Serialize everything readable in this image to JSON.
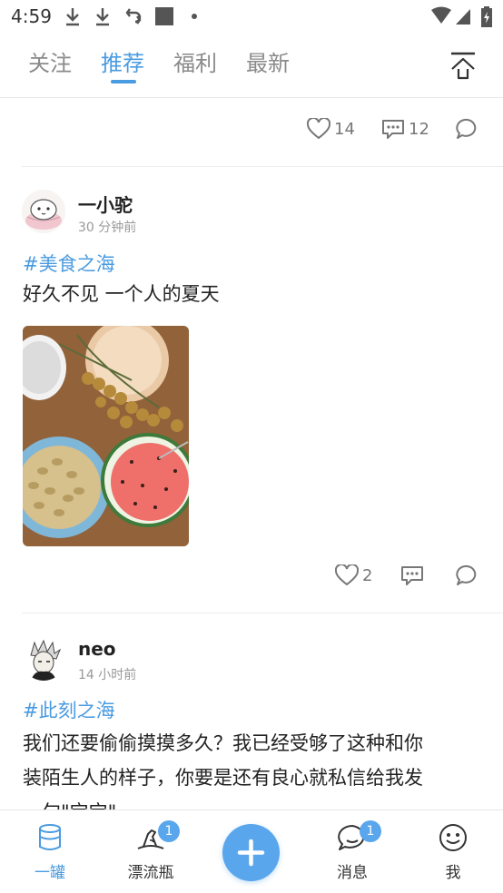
{
  "status_bar": {
    "time": "4:59"
  },
  "tabs": [
    {
      "label": "关注"
    },
    {
      "label": "推荐"
    },
    {
      "label": "福利"
    },
    {
      "label": "最新"
    }
  ],
  "prev_post": {
    "likes": "14",
    "comments": "12"
  },
  "posts": [
    {
      "username": "一小驼",
      "time": "30 分钟前",
      "topic": "#美食之海",
      "content": "好久不见 一个人的夏天",
      "likes": "2",
      "comments": ""
    },
    {
      "username": "neo",
      "time": "14 小时前",
      "topic": "#此刻之海",
      "content_lines": [
        "我们还要偷偷摸摸多久？我已经受够了这种和你",
        "装陌生人的样子，你要是还有良心就私信给我发",
        "一句\"宝宝\""
      ]
    }
  ],
  "bottom_nav": {
    "home": "一罐",
    "bottle": "漂流瓶",
    "bottle_badge": "1",
    "messages": "消息",
    "messages_badge": "1",
    "me": "我"
  },
  "colors": {
    "accent": "#4a9be0",
    "fab": "#5aa6ec"
  }
}
